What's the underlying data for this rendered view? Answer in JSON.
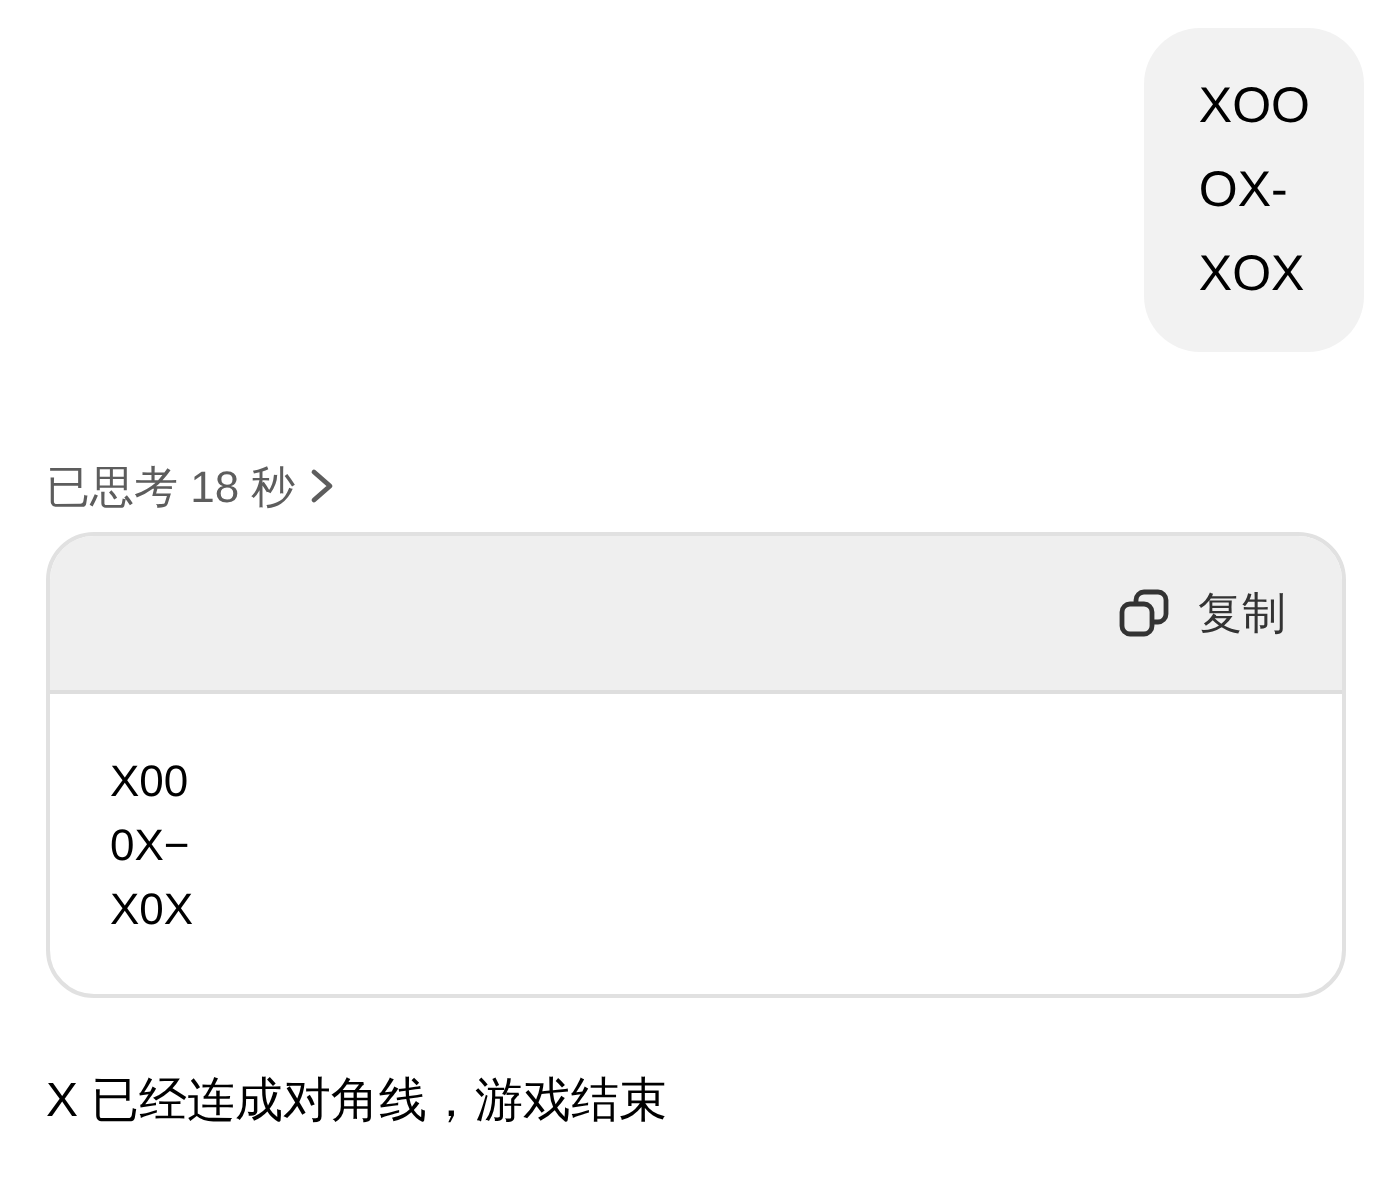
{
  "user_message": {
    "lines": [
      "XOO",
      "OX-",
      "XOX"
    ]
  },
  "thinking": {
    "label": "已思考 18 秒",
    "expanded": false
  },
  "code_block": {
    "copy_label": "复制",
    "lines": [
      "X00",
      "0X−",
      "X0X"
    ]
  },
  "reply": "X 已经连成对角线，游戏结束"
}
